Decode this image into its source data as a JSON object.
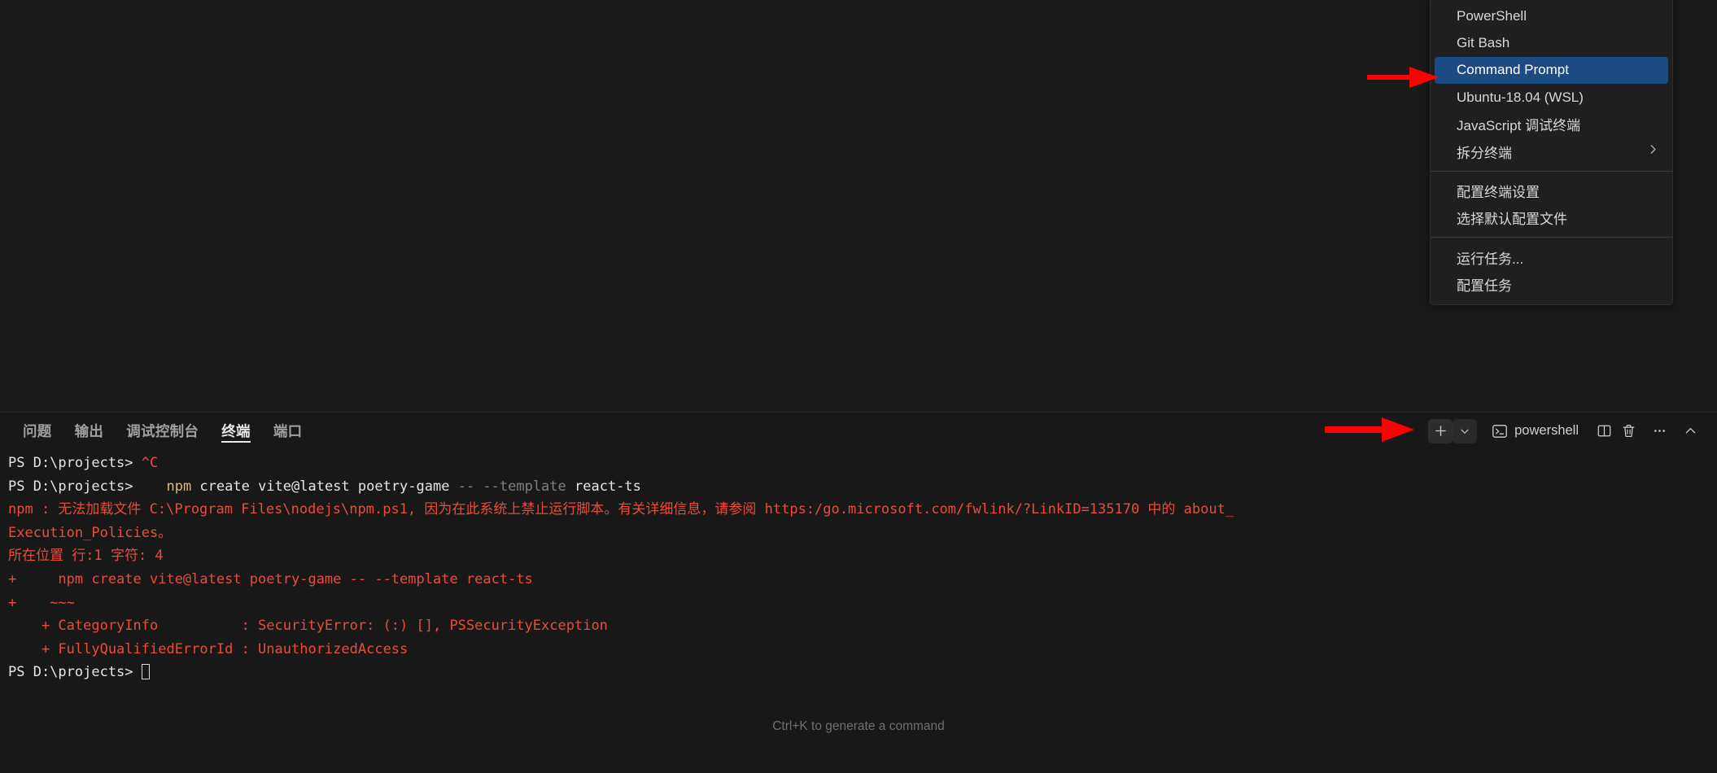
{
  "window": {
    "editor_background": "#1a1a1a",
    "panel_background": "#181818",
    "accent_selection": "#1c4b83",
    "error_color": "#e74c3c"
  },
  "panel": {
    "tabs": [
      {
        "label": "问题",
        "active": false
      },
      {
        "label": "输出",
        "active": false
      },
      {
        "label": "调试控制台",
        "active": false
      },
      {
        "label": "终端",
        "active": true
      },
      {
        "label": "端口",
        "active": false
      }
    ],
    "actions": {
      "new_terminal": "+",
      "new_terminal_dropdown": "chevron-down-icon",
      "active_terminal_icon": "terminal-icon",
      "active_terminal_label": "powershell",
      "split_terminal": "split-editor-icon",
      "kill_terminal": "trash-icon",
      "more_actions": "…",
      "collapse_panel": "chevron-up-icon"
    }
  },
  "terminal": {
    "hint": "Ctrl+K to generate a command",
    "lines": [
      {
        "id": "line-1",
        "segments": [
          {
            "text": "PS D:\\projects> ",
            "color": "prompt"
          },
          {
            "text": "^C",
            "color": "red"
          }
        ]
      },
      {
        "id": "line-2",
        "segments": [
          {
            "text": "PS D:\\projects>    ",
            "color": "prompt"
          },
          {
            "text": "npm",
            "color": "yellow"
          },
          {
            "text": " create vite@latest poetry-game ",
            "color": "white"
          },
          {
            "text": "-- --template",
            "color": "dim"
          },
          {
            "text": " react-ts",
            "color": "white"
          }
        ]
      },
      {
        "id": "line-3",
        "segments": [
          {
            "text": "npm : 无法加载文件 C:\\Program Files\\nodejs\\npm.ps1, 因为在此系统上禁止运行脚本。有关详细信息，请参阅 https:/go.microsoft.com/fwlink/?LinkID=135170 中的 about_",
            "color": "error"
          }
        ]
      },
      {
        "id": "line-4",
        "segments": [
          {
            "text": "Execution_Policies。",
            "color": "error"
          }
        ]
      },
      {
        "id": "line-5",
        "segments": [
          {
            "text": "所在位置 行:1 字符: 4",
            "color": "error"
          }
        ]
      },
      {
        "id": "line-6",
        "segments": [
          {
            "text": "+     npm create vite@latest poetry-game -- --template react-ts",
            "color": "error"
          }
        ]
      },
      {
        "id": "line-7",
        "segments": [
          {
            "text": "+    ~~~",
            "color": "error"
          }
        ]
      },
      {
        "id": "line-8",
        "segments": [
          {
            "text": "    + CategoryInfo          : SecurityError: (:) [], PSSecurityException",
            "color": "error"
          }
        ]
      },
      {
        "id": "line-9",
        "segments": [
          {
            "text": "    + FullyQualifiedErrorId : UnauthorizedAccess",
            "color": "error"
          }
        ]
      },
      {
        "id": "line-10",
        "segments": [
          {
            "text": "PS D:\\projects> ",
            "color": "prompt"
          }
        ],
        "cursor": true
      }
    ]
  },
  "context_menu": {
    "items": [
      {
        "label": "PowerShell",
        "type": "item",
        "selected": false
      },
      {
        "label": "Git Bash",
        "type": "item",
        "selected": false
      },
      {
        "label": "Command Prompt",
        "type": "item",
        "selected": true
      },
      {
        "label": "Ubuntu-18.04 (WSL)",
        "type": "item",
        "selected": false
      },
      {
        "label": "JavaScript 调试终端",
        "type": "item",
        "selected": false
      },
      {
        "label": "拆分终端",
        "type": "item",
        "selected": false,
        "submenu": true
      },
      {
        "type": "separator"
      },
      {
        "label": "配置终端设置",
        "type": "item",
        "selected": false
      },
      {
        "label": "选择默认配置文件",
        "type": "item",
        "selected": false
      },
      {
        "type": "separator"
      },
      {
        "label": "运行任务...",
        "type": "item",
        "selected": false
      },
      {
        "label": "配置任务",
        "type": "item",
        "selected": false
      }
    ]
  },
  "annotations": {
    "arrow_color": "#ff0000",
    "arrow_menu_target": "Command Prompt",
    "arrow_plus_target": "new-terminal-button"
  }
}
